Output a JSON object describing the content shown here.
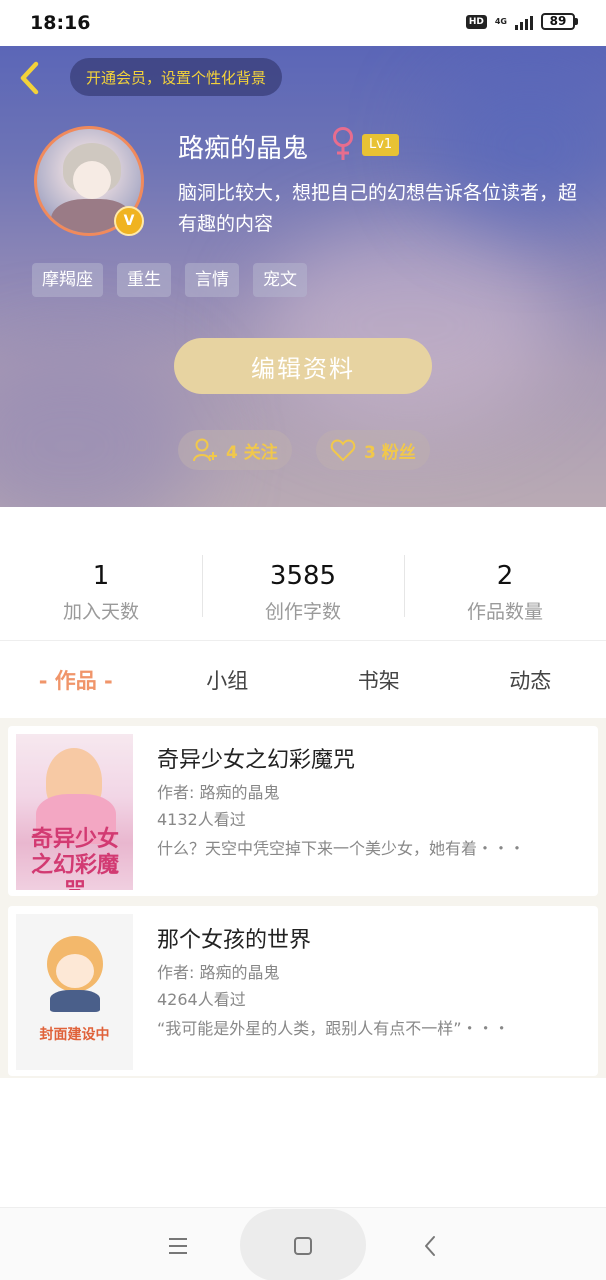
{
  "status_bar": {
    "time": "18:16",
    "hd": "HD",
    "network": "4G",
    "battery": "89"
  },
  "header": {
    "back_icon": "chevron-left-icon",
    "vip_banner": "开通会员，设置个性化背景",
    "user_name": "路痴的晶鬼",
    "gender_icon": "female-icon",
    "level": "Lv1",
    "verified_badge": "V",
    "bio": "脑洞比较大，想把自己的幻想告诉各位读者，超有趣的内容",
    "tags": [
      "摩羯座",
      "重生",
      "言情",
      "宠文"
    ],
    "edit_button": "编辑资料",
    "following": "4 关注",
    "fans": "3 粉丝",
    "accent_color": "#f1c84b"
  },
  "stats": [
    {
      "value": "1",
      "label": "加入天数"
    },
    {
      "value": "3585",
      "label": "创作字数"
    },
    {
      "value": "2",
      "label": "作品数量"
    }
  ],
  "tabs": [
    "- 作品 -",
    "小组",
    "书架",
    "动态"
  ],
  "active_tab_color": "#f0956a",
  "works": [
    {
      "title": "奇异少女之幻彩魔咒",
      "author": "作者: 路痴的晶鬼",
      "views": "4132人看过",
      "description": "什么？天空中凭空掉下来一个美少女，她有着・・・",
      "cover_text": "奇异少女之幻彩魔咒"
    },
    {
      "title": "那个女孩的世界",
      "author": "作者: 路痴的晶鬼",
      "views": "4264人看过",
      "description": "“我可能是外星的人类，跟别人有点不一样”・・・",
      "cover_text": "封面建设中"
    }
  ],
  "nav": {
    "menu_icon": "menu-icon",
    "home_icon": "home-square-icon",
    "back_icon": "back-chevron-icon"
  }
}
